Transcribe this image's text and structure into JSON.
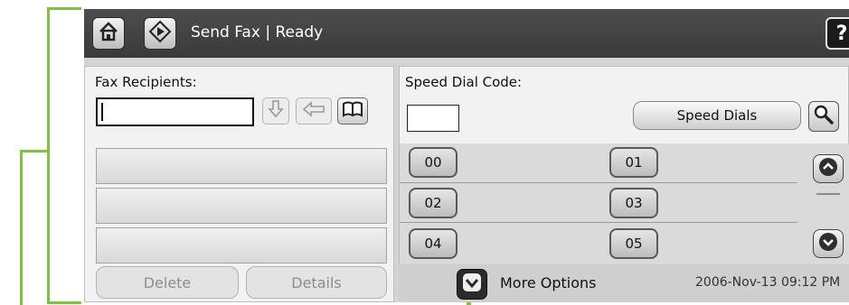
{
  "title_bar": {
    "home_icon": "home-icon",
    "start_icon": "start-diamond-icon",
    "title": "Send Fax | Ready",
    "help_label": "?"
  },
  "fax_recipients": {
    "label": "Fax Recipients:",
    "value": "",
    "icons": [
      "arrow-down-icon",
      "arrow-left-icon",
      "address-book-icon"
    ],
    "rows": [
      "",
      "",
      ""
    ],
    "delete_label": "Delete",
    "details_label": "Details"
  },
  "speed_dial": {
    "label": "Speed Dial Code:",
    "value": "",
    "button_label": "Speed Dials",
    "search_icon": "search-icon",
    "codes": [
      "00",
      "01",
      "02",
      "03",
      "04",
      "05"
    ],
    "scroll_up_icon": "chevron-up-icon",
    "scroll_down_icon": "chevron-down-icon"
  },
  "status_bar": {
    "more_options_label": "More Options",
    "more_options_icon": "chevron-down-icon",
    "datetime": "2006-Nov-13  09:12 PM"
  },
  "colors": {
    "title_bar": "#444444",
    "callout": "#7dc242",
    "panel": "#f2f2f2"
  }
}
